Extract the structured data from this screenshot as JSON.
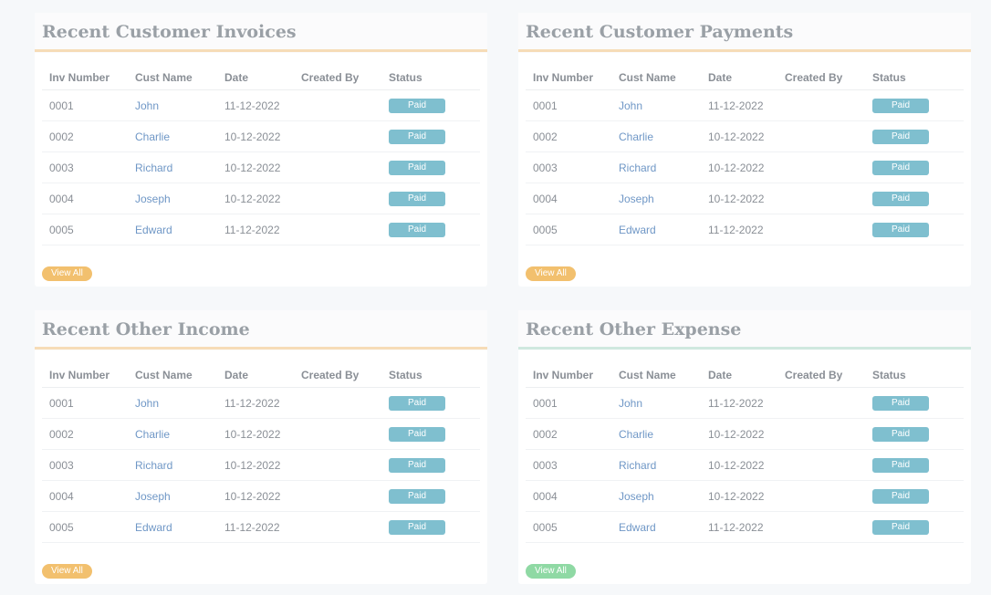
{
  "colors": {
    "badge": "#7fbfcf",
    "button_orange": "#f2c06e",
    "button_green": "#8fd9a4",
    "link": "#6f97c6"
  },
  "columns": [
    "Inv Number",
    "Cust Name",
    "Date",
    "Created By",
    "Status"
  ],
  "panels": [
    {
      "title": "Recent Customer Invoices",
      "button_label": "View All",
      "rows": [
        {
          "num": "0001",
          "name": "John",
          "date": "11-12-2022",
          "by": "",
          "status": "Paid"
        },
        {
          "num": "0002",
          "name": "Charlie",
          "date": "10-12-2022",
          "by": "",
          "status": "Paid"
        },
        {
          "num": "0003",
          "name": "Richard",
          "date": "10-12-2022",
          "by": "",
          "status": "Paid"
        },
        {
          "num": "0004",
          "name": "Joseph",
          "date": "10-12-2022",
          "by": "",
          "status": "Paid"
        },
        {
          "num": "0005",
          "name": "Edward",
          "date": "11-12-2022",
          "by": "",
          "status": "Paid"
        }
      ]
    },
    {
      "title": "Recent Customer Payments",
      "button_label": "View All",
      "rows": [
        {
          "num": "0001",
          "name": "John",
          "date": "11-12-2022",
          "by": "",
          "status": "Paid"
        },
        {
          "num": "0002",
          "name": "Charlie",
          "date": "10-12-2022",
          "by": "",
          "status": "Paid"
        },
        {
          "num": "0003",
          "name": "Richard",
          "date": "10-12-2022",
          "by": "",
          "status": "Paid"
        },
        {
          "num": "0004",
          "name": "Joseph",
          "date": "10-12-2022",
          "by": "",
          "status": "Paid"
        },
        {
          "num": "0005",
          "name": "Edward",
          "date": "11-12-2022",
          "by": "",
          "status": "Paid"
        }
      ]
    },
    {
      "title": "Recent Other Income",
      "button_label": "View All",
      "rows": [
        {
          "num": "0001",
          "name": "John",
          "date": "11-12-2022",
          "by": "",
          "status": "Paid"
        },
        {
          "num": "0002",
          "name": "Charlie",
          "date": "10-12-2022",
          "by": "",
          "status": "Paid"
        },
        {
          "num": "0003",
          "name": "Richard",
          "date": "10-12-2022",
          "by": "",
          "status": "Paid"
        },
        {
          "num": "0004",
          "name": "Joseph",
          "date": "10-12-2022",
          "by": "",
          "status": "Paid"
        },
        {
          "num": "0005",
          "name": "Edward",
          "date": "11-12-2022",
          "by": "",
          "status": "Paid"
        }
      ]
    },
    {
      "title": "Recent Other Expense",
      "button_label": "View All",
      "rows": [
        {
          "num": "0001",
          "name": "John",
          "date": "11-12-2022",
          "by": "",
          "status": "Paid"
        },
        {
          "num": "0002",
          "name": "Charlie",
          "date": "10-12-2022",
          "by": "",
          "status": "Paid"
        },
        {
          "num": "0003",
          "name": "Richard",
          "date": "10-12-2022",
          "by": "",
          "status": "Paid"
        },
        {
          "num": "0004",
          "name": "Joseph",
          "date": "10-12-2022",
          "by": "",
          "status": "Paid"
        },
        {
          "num": "0005",
          "name": "Edward",
          "date": "11-12-2022",
          "by": "",
          "status": "Paid"
        }
      ]
    }
  ]
}
